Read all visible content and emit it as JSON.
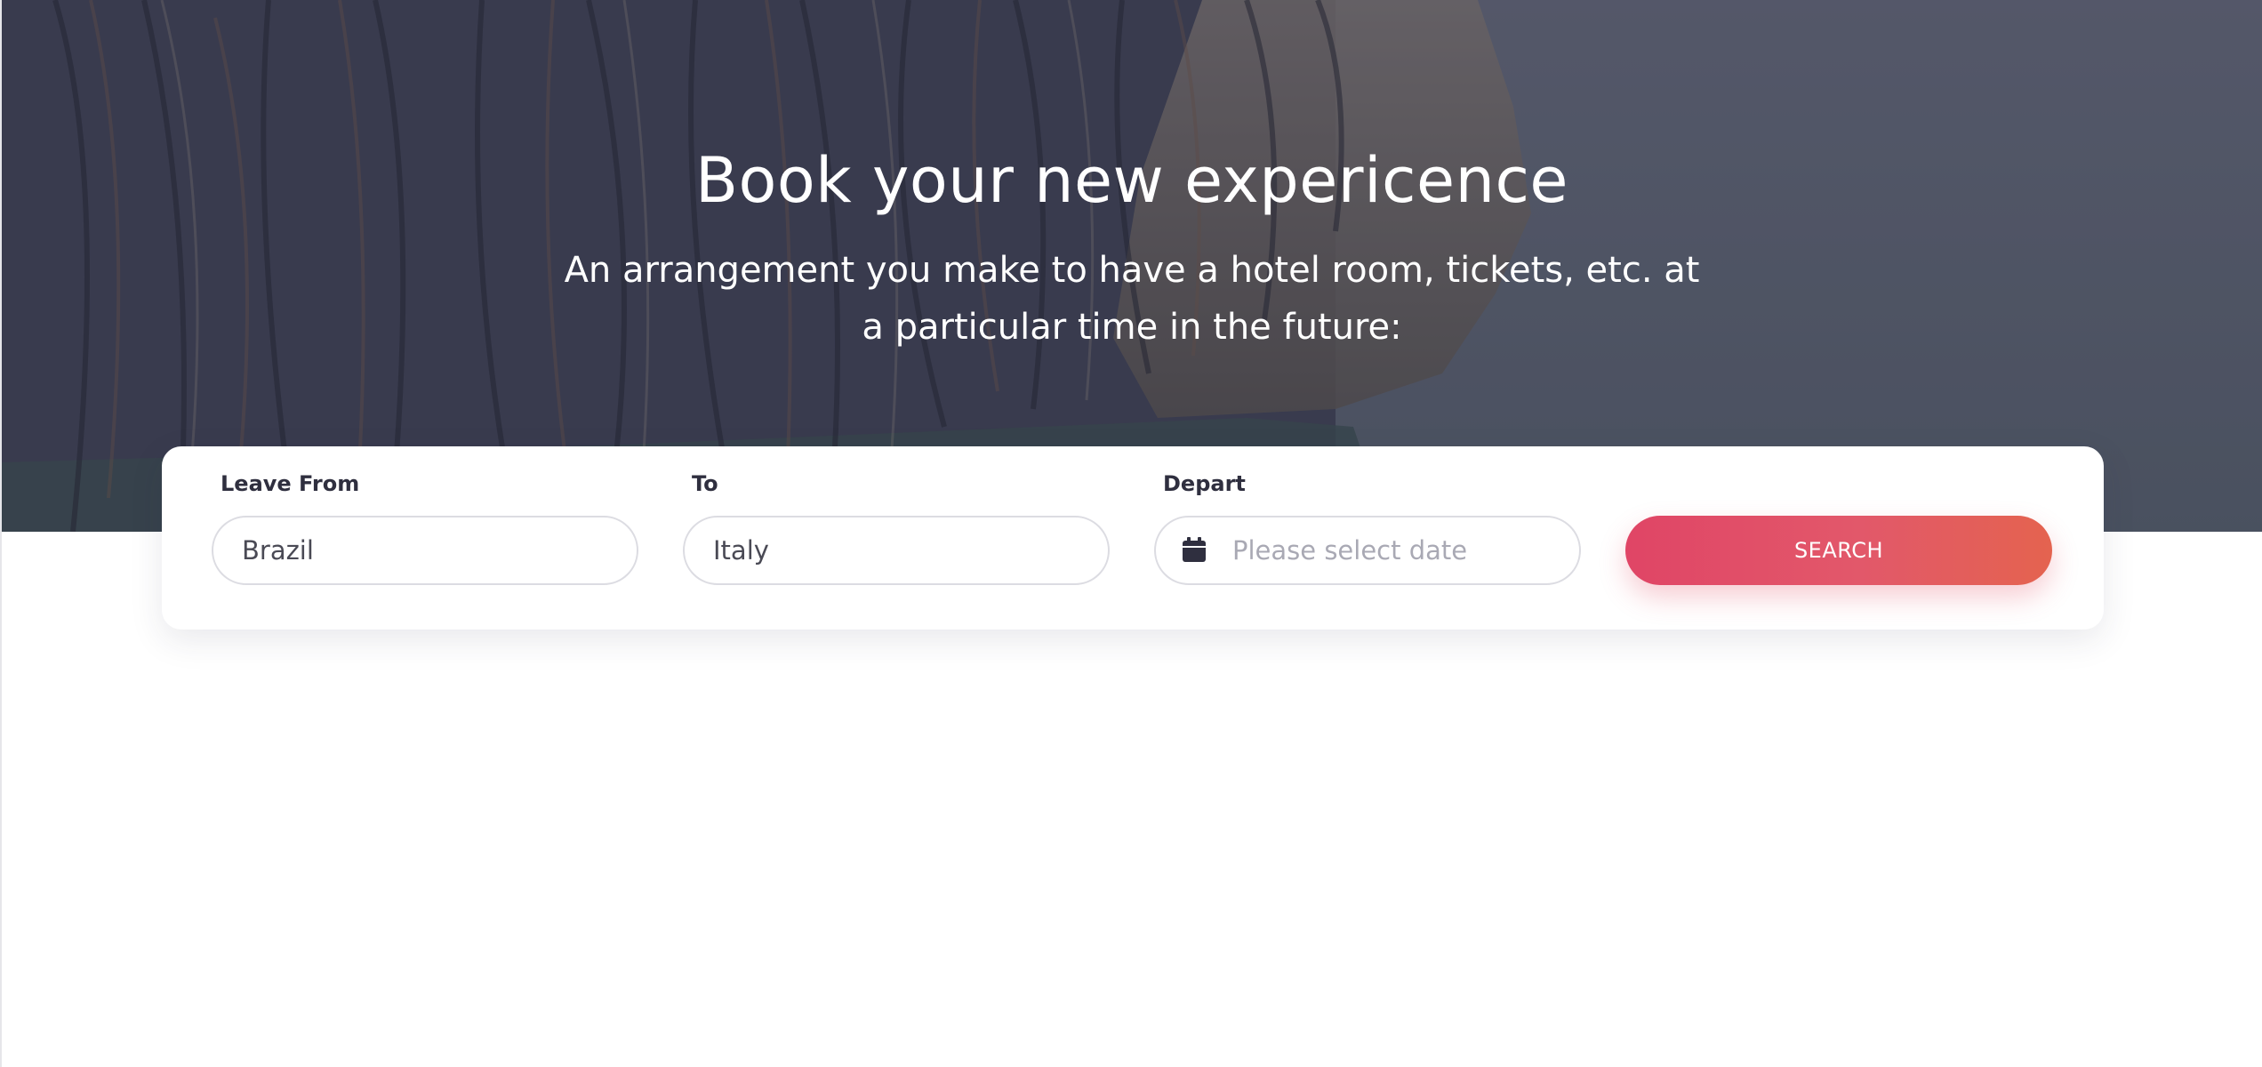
{
  "hero": {
    "title": "Book your new expericence",
    "subtitle": "An arrangement you make to have a hotel room, tickets, etc. at a particular time in the future:"
  },
  "search_form": {
    "leave_from": {
      "label": "Leave From",
      "value": "Brazil"
    },
    "to": {
      "label": "To",
      "value": "Italy"
    },
    "depart": {
      "label": "Depart",
      "placeholder": "Please select date",
      "icon": "calendar-icon"
    },
    "search_label": "SEARCH"
  },
  "colors": {
    "button_gradient_start": "#e04566",
    "button_gradient_end": "#e4634f",
    "label_text": "#2f2f3f",
    "input_border": "#dcdce2"
  }
}
